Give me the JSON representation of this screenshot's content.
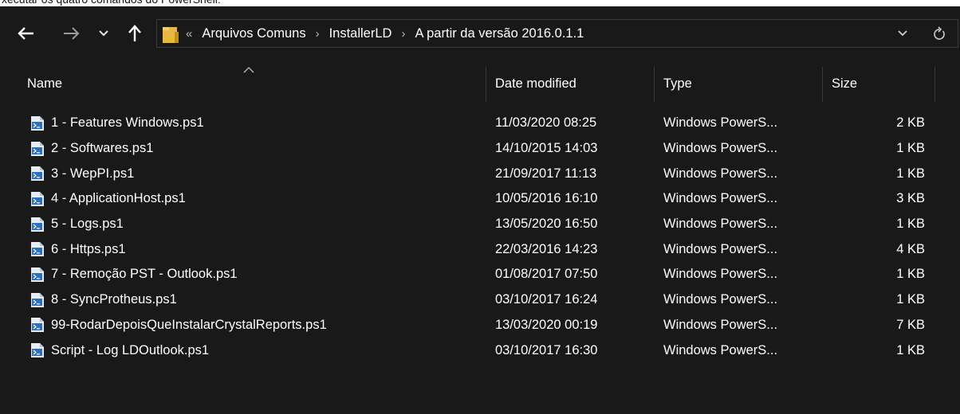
{
  "caption": "xecutar os quatro comandos do PowerShell:",
  "nav": {
    "back_icon": "arrow-left-icon",
    "forward_icon": "arrow-right-icon",
    "recent_icon": "chevron-down-icon",
    "up_icon": "arrow-up-icon"
  },
  "address": {
    "overflow": "«",
    "crumbs": [
      "Arquivos Comuns",
      "InstallerLD",
      "A partir da versão 2016.0.1.1"
    ],
    "separator": "›"
  },
  "columns": {
    "name": "Name",
    "date": "Date modified",
    "type": "Type",
    "size": "Size"
  },
  "files": [
    {
      "name": "1 - Features Windows.ps1",
      "date": "11/03/2020 08:25",
      "type": "Windows PowerS...",
      "size": "2 KB"
    },
    {
      "name": "2 - Softwares.ps1",
      "date": "14/10/2015 14:03",
      "type": "Windows PowerS...",
      "size": "1 KB"
    },
    {
      "name": "3 - WepPI.ps1",
      "date": "21/09/2017 11:13",
      "type": "Windows PowerS...",
      "size": "1 KB"
    },
    {
      "name": "4 - ApplicationHost.ps1",
      "date": "10/05/2016 16:10",
      "type": "Windows PowerS...",
      "size": "3 KB"
    },
    {
      "name": "5 - Logs.ps1",
      "date": "13/05/2020 16:50",
      "type": "Windows PowerS...",
      "size": "1 KB"
    },
    {
      "name": "6 - Https.ps1",
      "date": "22/03/2016 14:23",
      "type": "Windows PowerS...",
      "size": "4 KB"
    },
    {
      "name": "7 - Remoção PST - Outlook.ps1",
      "date": "01/08/2017 07:50",
      "type": "Windows PowerS...",
      "size": "1 KB"
    },
    {
      "name": "8 - SyncProtheus.ps1",
      "date": "03/10/2017 16:24",
      "type": "Windows PowerS...",
      "size": "1 KB"
    },
    {
      "name": "99-RodarDepoisQueInstalarCrystalReports.ps1",
      "date": "13/03/2020 00:19",
      "type": "Windows PowerS...",
      "size": "7 KB"
    },
    {
      "name": "Script - Log LDOutlook.ps1",
      "date": "03/10/2017 16:30",
      "type": "Windows PowerS...",
      "size": "1 KB"
    }
  ]
}
